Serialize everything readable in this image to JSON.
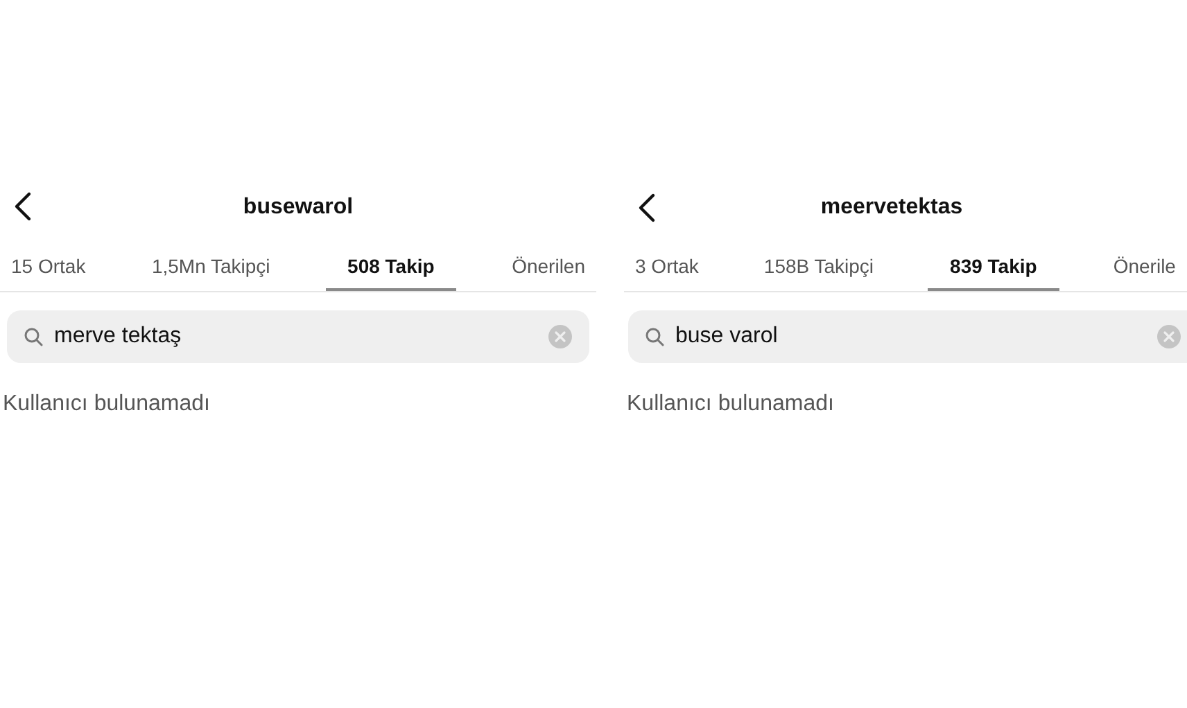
{
  "panels": [
    {
      "title": "busewarol",
      "tabs": [
        {
          "label": "15 Ortak",
          "selected": false
        },
        {
          "label": "1,5Mn Takipçi",
          "selected": false
        },
        {
          "label": "508 Takip",
          "selected": true
        },
        {
          "label": "Önerilen",
          "selected": false
        }
      ],
      "search": {
        "value": "merve tektaş"
      },
      "message": "Kullanıcı bulunamadı"
    },
    {
      "title": "meervetektas",
      "tabs": [
        {
          "label": "3 Ortak",
          "selected": false
        },
        {
          "label": "158B Takipçi",
          "selected": false
        },
        {
          "label": "839 Takip",
          "selected": true
        },
        {
          "label": "Önerile",
          "selected": false
        }
      ],
      "search": {
        "value": "buse varol"
      },
      "message": "Kullanıcı bulunamadı"
    }
  ]
}
